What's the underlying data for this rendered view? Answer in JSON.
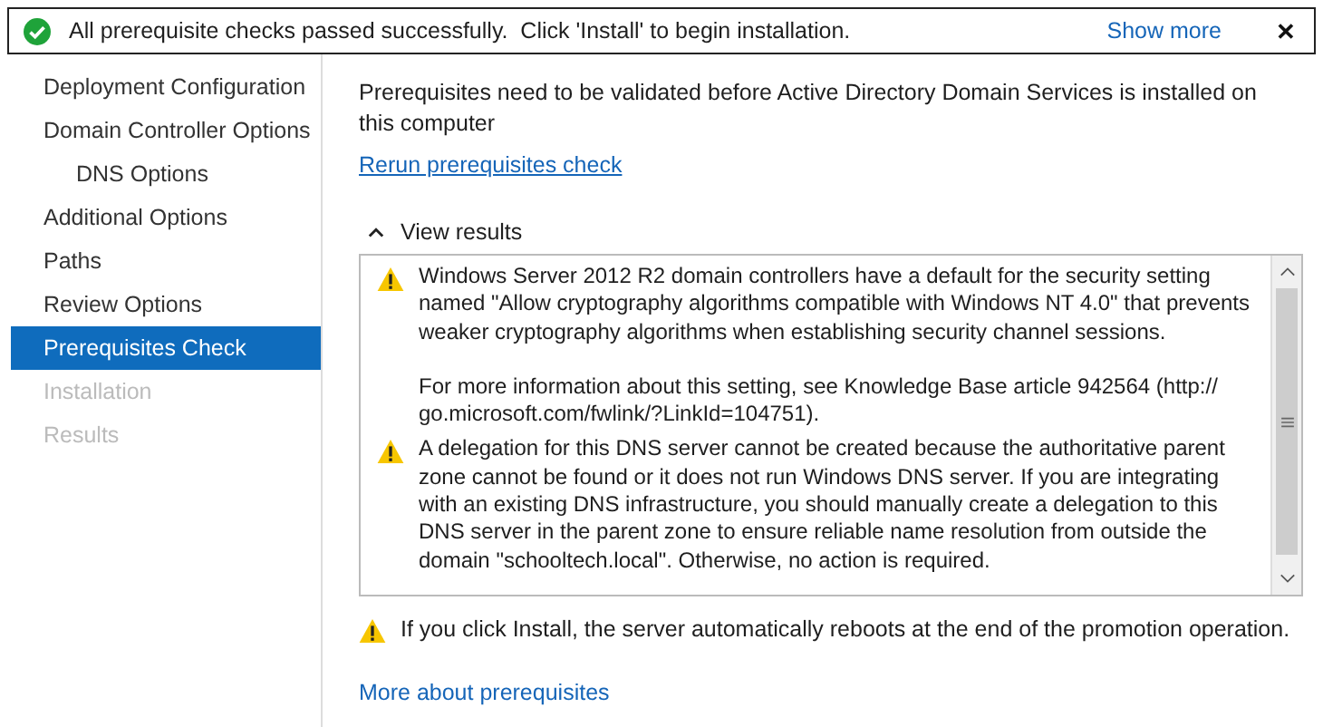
{
  "banner": {
    "kind": "success",
    "message": "All prerequisite checks passed successfully.  Click 'Install' to begin installation.",
    "show_more": "Show more",
    "close": "✕"
  },
  "sidebar": {
    "items": [
      {
        "label": "Deployment Configuration",
        "selected": false,
        "disabled": false
      },
      {
        "label": "Domain Controller Options",
        "selected": false,
        "disabled": false,
        "children": [
          {
            "label": "DNS Options",
            "selected": false,
            "disabled": false
          }
        ]
      },
      {
        "label": "Additional Options",
        "selected": false,
        "disabled": false
      },
      {
        "label": "Paths",
        "selected": false,
        "disabled": false
      },
      {
        "label": "Review Options",
        "selected": false,
        "disabled": false
      },
      {
        "label": "Prerequisites Check",
        "selected": true,
        "disabled": false
      },
      {
        "label": "Installation",
        "selected": false,
        "disabled": true
      },
      {
        "label": "Results",
        "selected": false,
        "disabled": true
      }
    ]
  },
  "content": {
    "intro": "Prerequisites need to be validated before Active Directory Domain Services is installed on this computer",
    "rerun_link": "Rerun prerequisites check",
    "view_results": {
      "label": "View results",
      "expanded": true
    },
    "results": [
      {
        "kind": "warning",
        "paragraphs": [
          "Windows Server 2012 R2 domain controllers have a default for the security setting named \"Allow cryptography algorithms compatible with Windows NT 4.0\" that prevents weaker cryptography algorithms when establishing security channel sessions.",
          "For more information about this setting, see Knowledge Base article 942564 (http:// go.microsoft.com/fwlink/?LinkId=104751)."
        ]
      },
      {
        "kind": "warning",
        "paragraphs": [
          "A delegation for this DNS server cannot be created because the authoritative parent zone cannot be found or it does not run Windows DNS server. If you are integrating with an existing DNS infrastructure, you should manually create a delegation to this DNS server in the parent zone to ensure reliable name resolution from outside the domain \"schooltech.local\". Otherwise, no action is required."
        ]
      }
    ],
    "reboot_note": {
      "kind": "warning",
      "text": "If you click Install, the server automatically reboots at the end of the promotion operation."
    },
    "more_link": "More about prerequisites"
  }
}
